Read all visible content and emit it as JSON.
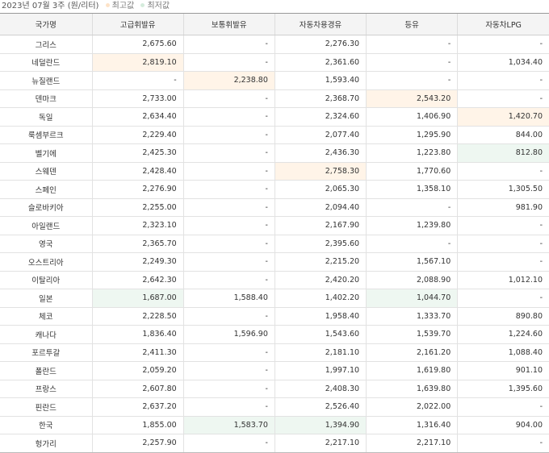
{
  "caption": {
    "period": "2023년 07월 3주",
    "unit": "(원/리터)",
    "max_label": "최고값",
    "min_label": "최저값",
    "max_color": "#fde3c8",
    "min_color": "#d5ecdc"
  },
  "table": {
    "headers": [
      "국가명",
      "고급휘발유",
      "보통휘발유",
      "자동차용경유",
      "등유",
      "자동차LPG"
    ],
    "rows": [
      {
        "country": "그리스",
        "cells": [
          "2,675.60",
          "-",
          "2,276.30",
          "-",
          "-"
        ],
        "marks": [
          "",
          "",
          "",
          "",
          ""
        ]
      },
      {
        "country": "네덜란드",
        "cells": [
          "2,819.10",
          "-",
          "2,361.60",
          "-",
          "1,034.40"
        ],
        "marks": [
          "max",
          "",
          "",
          "",
          ""
        ]
      },
      {
        "country": "뉴질랜드",
        "cells": [
          "-",
          "2,238.80",
          "1,593.40",
          "-",
          "-"
        ],
        "marks": [
          "",
          "max",
          "",
          "",
          ""
        ]
      },
      {
        "country": "덴마크",
        "cells": [
          "2,733.00",
          "-",
          "2,368.70",
          "2,543.20",
          "-"
        ],
        "marks": [
          "",
          "",
          "",
          "max",
          ""
        ]
      },
      {
        "country": "독일",
        "cells": [
          "2,634.40",
          "-",
          "2,324.60",
          "1,406.90",
          "1,420.70"
        ],
        "marks": [
          "",
          "",
          "",
          "",
          "max"
        ]
      },
      {
        "country": "룩셈부르크",
        "cells": [
          "2,229.40",
          "-",
          "2,077.40",
          "1,295.90",
          "844.00"
        ],
        "marks": [
          "",
          "",
          "",
          "",
          ""
        ]
      },
      {
        "country": "벨기에",
        "cells": [
          "2,425.30",
          "-",
          "2,436.30",
          "1,223.80",
          "812.80"
        ],
        "marks": [
          "",
          "",
          "",
          "",
          "min"
        ]
      },
      {
        "country": "스웨덴",
        "cells": [
          "2,428.40",
          "-",
          "2,758.30",
          "1,770.60",
          "-"
        ],
        "marks": [
          "",
          "",
          "max",
          "",
          ""
        ]
      },
      {
        "country": "스페인",
        "cells": [
          "2,276.90",
          "-",
          "2,065.30",
          "1,358.10",
          "1,305.50"
        ],
        "marks": [
          "",
          "",
          "",
          "",
          ""
        ]
      },
      {
        "country": "슬로바키아",
        "cells": [
          "2,255.00",
          "-",
          "2,094.40",
          "-",
          "981.90"
        ],
        "marks": [
          "",
          "",
          "",
          "",
          ""
        ]
      },
      {
        "country": "아일랜드",
        "cells": [
          "2,323.10",
          "-",
          "2,167.90",
          "1,239.80",
          "-"
        ],
        "marks": [
          "",
          "",
          "",
          "",
          ""
        ]
      },
      {
        "country": "영국",
        "cells": [
          "2,365.70",
          "-",
          "2,395.60",
          "-",
          "-"
        ],
        "marks": [
          "",
          "",
          "",
          "",
          ""
        ]
      },
      {
        "country": "오스트리아",
        "cells": [
          "2,249.30",
          "-",
          "2,215.20",
          "1,567.10",
          "-"
        ],
        "marks": [
          "",
          "",
          "",
          "",
          ""
        ]
      },
      {
        "country": "이탈리아",
        "cells": [
          "2,642.30",
          "-",
          "2,420.20",
          "2,088.90",
          "1,012.10"
        ],
        "marks": [
          "",
          "",
          "",
          "",
          ""
        ]
      },
      {
        "country": "일본",
        "cells": [
          "1,687.00",
          "1,588.40",
          "1,402.20",
          "1,044.70",
          "-"
        ],
        "marks": [
          "min",
          "",
          "",
          "min",
          ""
        ]
      },
      {
        "country": "체코",
        "cells": [
          "2,228.50",
          "-",
          "1,958.40",
          "1,333.70",
          "890.80"
        ],
        "marks": [
          "",
          "",
          "",
          "",
          ""
        ]
      },
      {
        "country": "캐나다",
        "cells": [
          "1,836.40",
          "1,596.90",
          "1,543.60",
          "1,539.70",
          "1,224.60"
        ],
        "marks": [
          "",
          "",
          "",
          "",
          ""
        ]
      },
      {
        "country": "포르투갈",
        "cells": [
          "2,411.30",
          "-",
          "2,181.10",
          "2,161.20",
          "1,088.40"
        ],
        "marks": [
          "",
          "",
          "",
          "",
          ""
        ]
      },
      {
        "country": "폴란드",
        "cells": [
          "2,059.20",
          "-",
          "1,997.10",
          "1,619.80",
          "901.10"
        ],
        "marks": [
          "",
          "",
          "",
          "",
          ""
        ]
      },
      {
        "country": "프랑스",
        "cells": [
          "2,607.80",
          "-",
          "2,408.30",
          "1,639.80",
          "1,395.60"
        ],
        "marks": [
          "",
          "",
          "",
          "",
          ""
        ]
      },
      {
        "country": "핀란드",
        "cells": [
          "2,637.20",
          "-",
          "2,526.40",
          "2,022.00",
          "-"
        ],
        "marks": [
          "",
          "",
          "",
          "",
          ""
        ]
      },
      {
        "country": "한국",
        "cells": [
          "1,855.00",
          "1,583.70",
          "1,394.90",
          "1,316.40",
          "904.00"
        ],
        "marks": [
          "",
          "min",
          "min",
          "",
          ""
        ]
      },
      {
        "country": "헝가리",
        "cells": [
          "2,257.90",
          "-",
          "2,217.10",
          "2,217.10",
          "-"
        ],
        "marks": [
          "",
          "",
          "",
          "",
          ""
        ]
      }
    ]
  }
}
